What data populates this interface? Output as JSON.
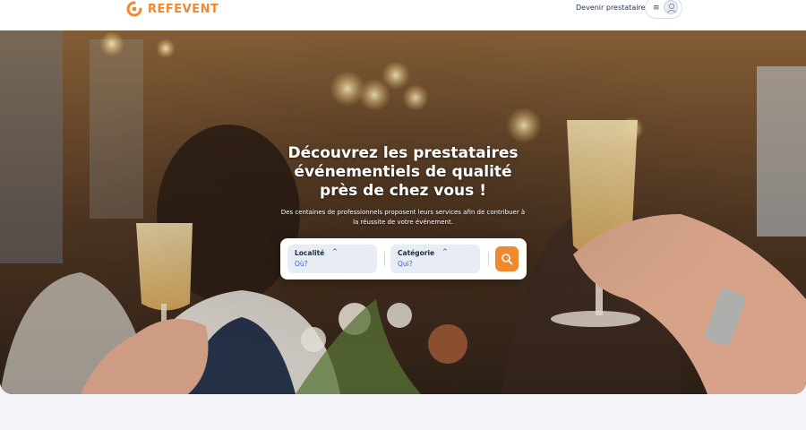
{
  "header": {
    "logo_text": "REFEVENT",
    "become_provider": "Devenir prestataire",
    "menu_icon": "hamburger-menu-icon",
    "user_icon": "user-avatar-icon"
  },
  "hero": {
    "title_lines": [
      "Découvrez les prestataires",
      "événementiels de qualité",
      "près de chez vous !"
    ],
    "subtitle_lines": [
      "Des centaines de professionnels proposent leurs services afin de contribuer à",
      "la réussite de votre événement."
    ]
  },
  "search": {
    "location": {
      "label": "Localité",
      "value": "Où?"
    },
    "category": {
      "label": "Catégorie",
      "value": "Qui?"
    },
    "button_icon": "search-icon"
  },
  "colors": {
    "brand": "#f0892b",
    "navy": "#1f3150",
    "field_bg": "#e8edf4"
  }
}
